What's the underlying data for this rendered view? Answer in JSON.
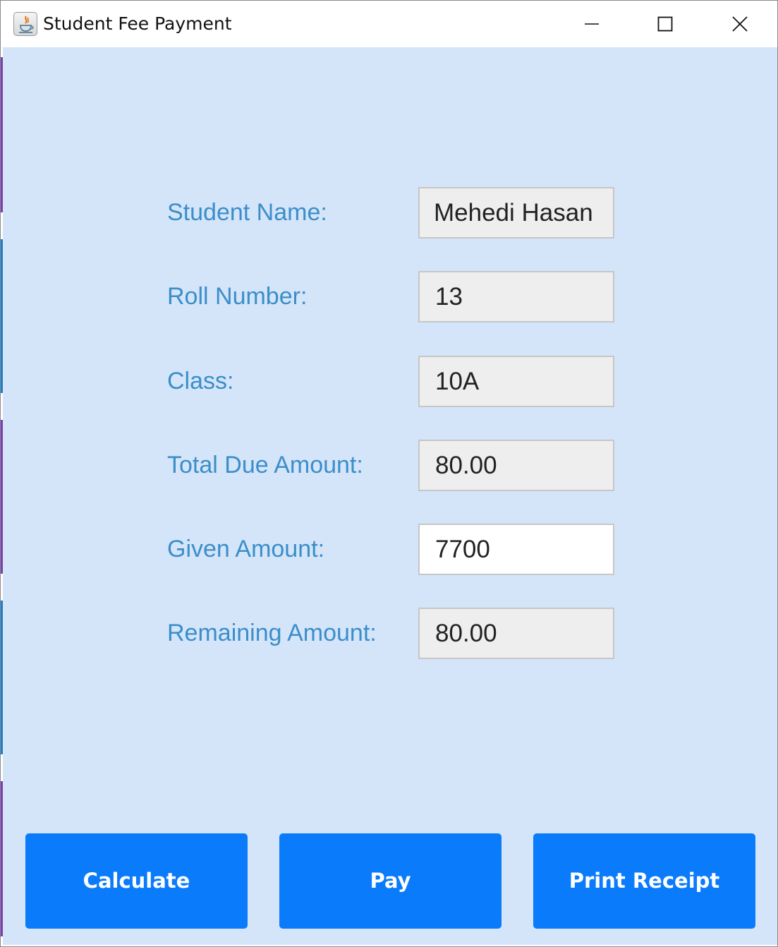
{
  "window": {
    "title": "Student Fee Payment",
    "icon": "java-cup-icon",
    "controls": [
      "minimize-icon",
      "maximize-icon",
      "close-icon"
    ]
  },
  "form": {
    "student_name": {
      "label": "Student Name:",
      "value": "Mehedi Hasan"
    },
    "roll_number": {
      "label": "Roll Number:",
      "value": "13"
    },
    "class": {
      "label": "Class:",
      "value": "10A"
    },
    "total_due": {
      "label": "Total Due Amount:",
      "value": "80.00"
    },
    "given_amount": {
      "label": "Given Amount:",
      "value": "7700"
    },
    "remaining_amount": {
      "label": "Remaining Amount:",
      "value": "80.00"
    }
  },
  "actions": {
    "calculate": "Calculate",
    "pay": "Pay",
    "print_receipt": "Print Receipt"
  },
  "colors": {
    "background": "#d4e5fa",
    "label": "#3b8ec9",
    "button": "#0a7bfb",
    "button_text": "#ffffff",
    "field_readonly": "#eeeeee",
    "field_editable": "#ffffff"
  }
}
